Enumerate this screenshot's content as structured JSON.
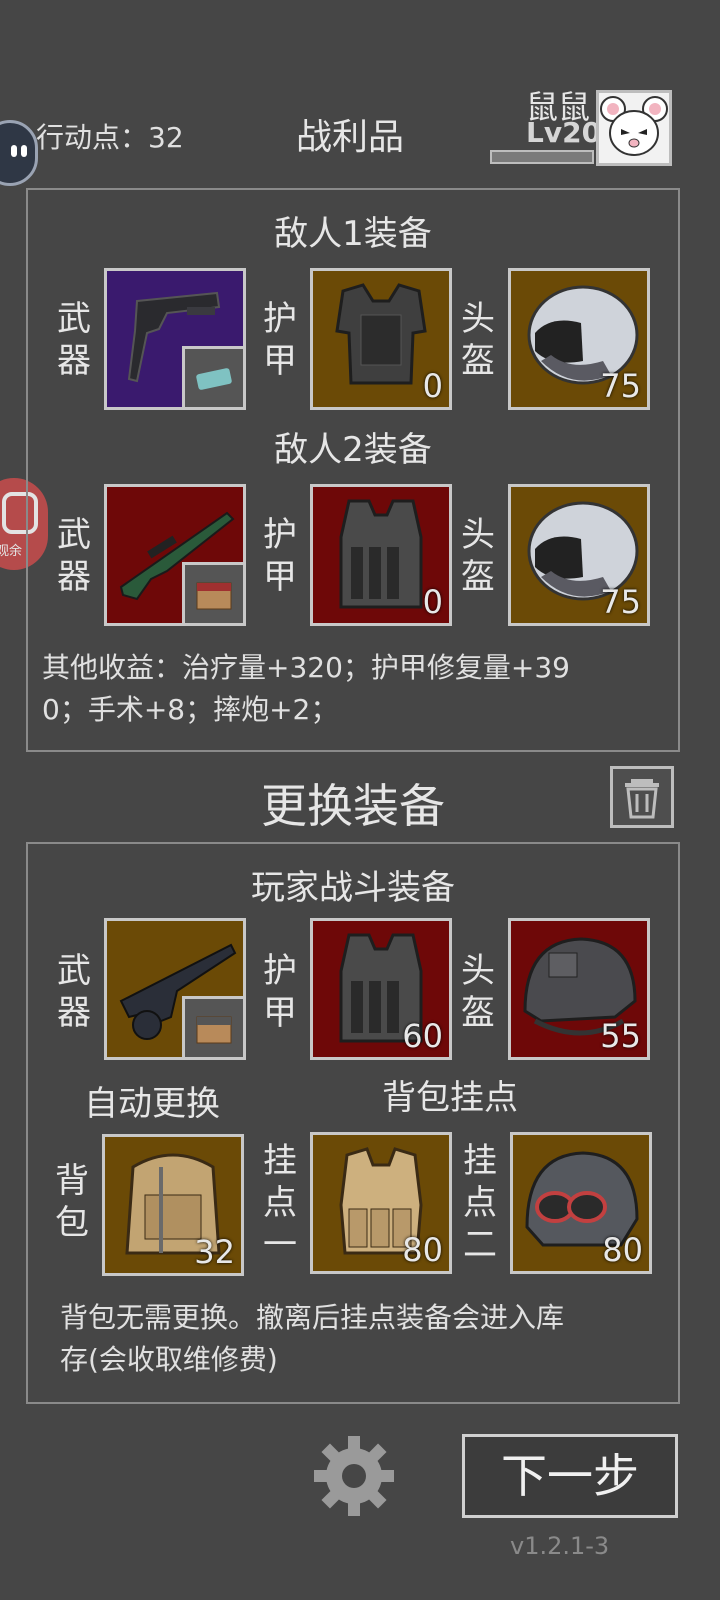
{
  "header": {
    "action_points_label": "行动点：32",
    "title": "战利品",
    "player_name": "鼠鼠",
    "player_level": "Lv20"
  },
  "loot": {
    "enemy1_title": "敌人1装备",
    "enemy2_title": "敌人2装备",
    "labels": {
      "weapon": "武器",
      "armor": "护甲",
      "helmet": "头盔"
    },
    "enemy1": {
      "armor_value": "0",
      "helmet_value": "75"
    },
    "enemy2": {
      "armor_value": "0",
      "helmet_value": "75"
    },
    "other_gains_line1": "其他收益：治疗量+320；护甲修复量+39",
    "other_gains_line2": "0；手术+8；摔炮+2；"
  },
  "change": {
    "title": "更换装备",
    "player_title": "玩家战斗装备",
    "armor_value": "60",
    "helmet_value": "55",
    "auto_replace": "自动更换",
    "backpack_mount_title": "背包挂点",
    "backpack_label": "背包",
    "mount1_label": "挂点一",
    "mount2_label": "挂点二",
    "backpack_value": "32",
    "mount1_value": "80",
    "mount2_value": "80",
    "note_line1": "背包无需更换。撤离后挂点装备会进入库",
    "note_line2": "存(会收取维修费)"
  },
  "footer": {
    "next_button": "下一步",
    "version": "v1.2.1-3"
  },
  "side": {
    "ad_badge": "观余"
  },
  "colors": {
    "bg": "#464646",
    "purple_rarity": "#3a1a6e",
    "gold_rarity": "#6b4a06",
    "red_rarity": "#6e0808"
  }
}
